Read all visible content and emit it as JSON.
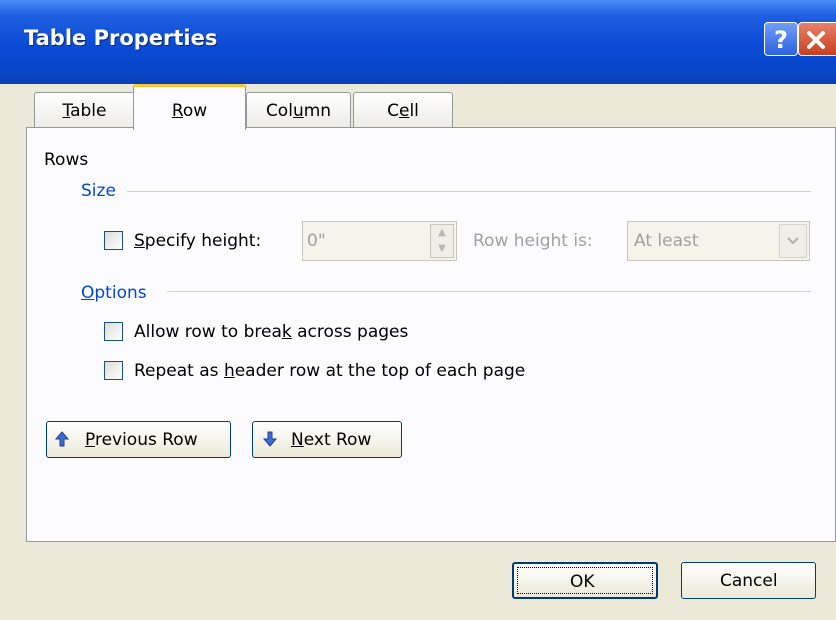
{
  "window": {
    "title": "Table Properties",
    "help_label": "?"
  },
  "tabs": [
    {
      "id": "table",
      "label_pre": "",
      "label_u": "T",
      "label_post": "able",
      "selected": false
    },
    {
      "id": "row",
      "label_pre": "",
      "label_u": "R",
      "label_post": "ow",
      "selected": true
    },
    {
      "id": "column",
      "label_pre": "Col",
      "label_u": "u",
      "label_post": "mn",
      "selected": false
    },
    {
      "id": "cell",
      "label_pre": "C",
      "label_u": "e",
      "label_post": "ll",
      "selected": false
    }
  ],
  "rows_section": {
    "heading": "Rows",
    "size_label": "Size",
    "specify_height": {
      "pre": "",
      "u": "S",
      "post": "pecify height:",
      "checked": false
    },
    "height_value": "0\"",
    "row_height_label": "Row height is:",
    "row_height_select": "At least",
    "options_label_u": "O",
    "options_label_post": "ptions",
    "allow_break": {
      "pre": "Allow row to brea",
      "u": "k",
      "post": " across pages",
      "checked": false
    },
    "repeat_header": {
      "pre": "Repeat as ",
      "u": "h",
      "post": "eader row at the top of each page",
      "checked": false
    }
  },
  "nav_buttons": {
    "previous": {
      "pre": "",
      "u": "P",
      "post": "revious Row"
    },
    "next": {
      "pre": "",
      "u": "N",
      "post": "ext Row"
    }
  },
  "footer": {
    "ok_label": "OK",
    "cancel_label": "Cancel"
  },
  "colors": {
    "titlebar": "#0a4bd6",
    "face": "#ece9d8",
    "group_label": "#0046d5",
    "tab_highlight": "#ffc73c"
  }
}
